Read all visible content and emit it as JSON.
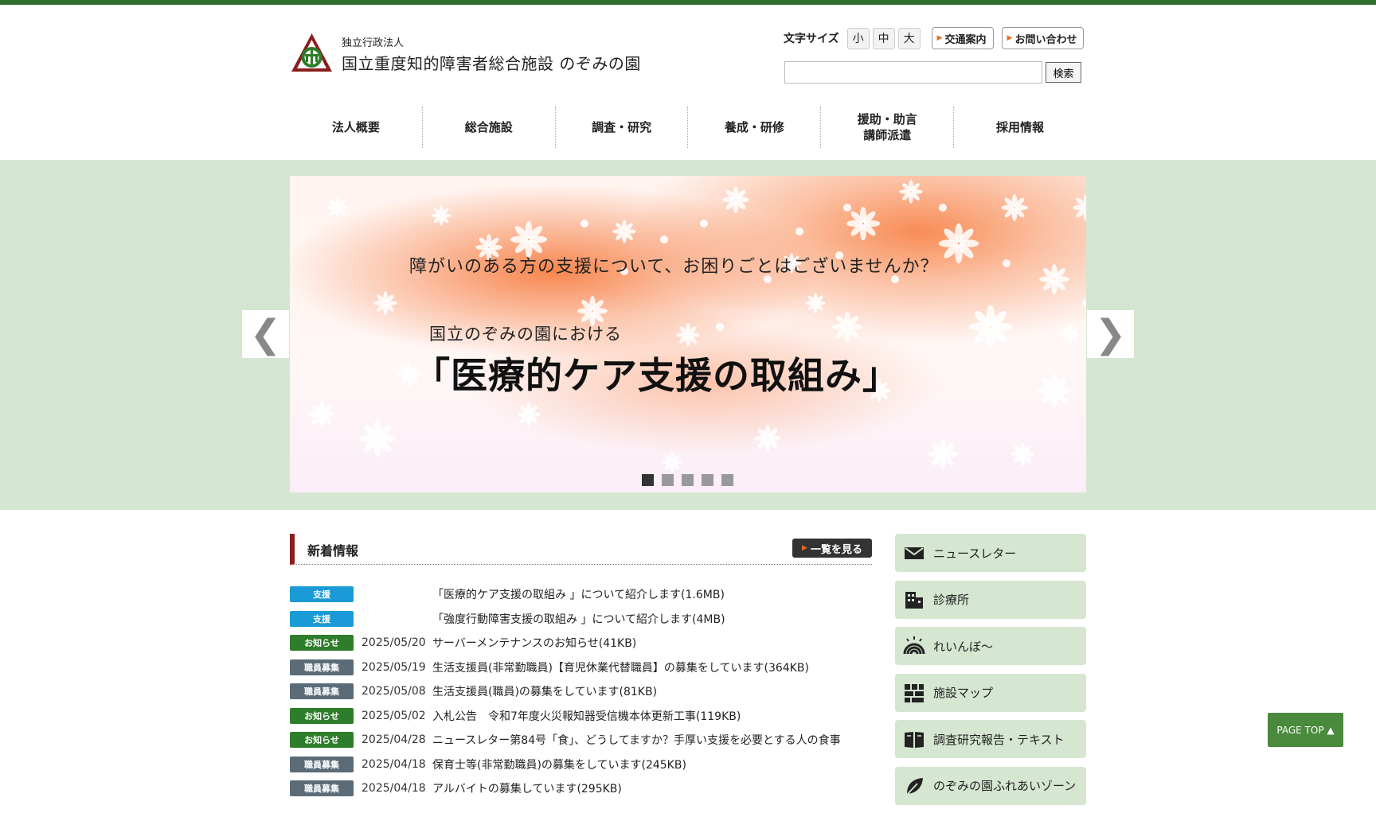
{
  "header": {
    "logo_sub": "独立行政法人",
    "logo_main": "国立重度知的障害者総合施設 のぞみの園",
    "font_size_label": "文字サイズ",
    "font_sizes": [
      "小",
      "中",
      "大"
    ],
    "access_label": "交通案内",
    "contact_label": "お問い合わせ",
    "search_button": "検索",
    "search_value": ""
  },
  "nav": {
    "items": [
      "法人概要",
      "総合施設",
      "調査・研究",
      "養成・研修",
      "援助・助言\n講師派遣",
      "採用情報"
    ]
  },
  "hero": {
    "question": "障がいのある方の支援について、お困りごとはございませんか？",
    "subtitle": "国立のぞみの園における",
    "title": "「医療的ケア支援の取組み」",
    "prev_arrow": "❮",
    "next_arrow": "❯",
    "slide_count": 5,
    "active_slide": 1
  },
  "news": {
    "title": "新着情報",
    "more_label": "一覧を見る",
    "items": [
      {
        "category": "支援",
        "color": "#1a9ad6",
        "date": "",
        "text": "「医療的ケア支援の取組み 」について紹介します(1.6MB)"
      },
      {
        "category": "支援",
        "color": "#1a9ad6",
        "date": "",
        "text": "「強度行動障害支援の取組み 」について紹介します(4MB)"
      },
      {
        "category": "お知らせ",
        "color": "#2e7d2a",
        "date": "2025/05/20",
        "text": "サーバーメンテナンスのお知らせ(41KB)"
      },
      {
        "category": "職員募集",
        "color": "#5b6b78",
        "date": "2025/05/19",
        "text": "生活支援員(非常勤職員)【育児休業代替職員】の募集をしています(364KB)"
      },
      {
        "category": "職員募集",
        "color": "#5b6b78",
        "date": "2025/05/08",
        "text": "生活支援員(職員)の募集をしています(81KB)"
      },
      {
        "category": "お知らせ",
        "color": "#2e7d2a",
        "date": "2025/05/02",
        "text": "入札公告　令和7年度火災報知器受信機本体更新工事(119KB)"
      },
      {
        "category": "お知らせ",
        "color": "#2e7d2a",
        "date": "2025/04/28",
        "text": "ニュースレター第84号「食」、どうしてますか？手厚い支援を必要とする人の食事"
      },
      {
        "category": "職員募集",
        "color": "#5b6b78",
        "date": "2025/04/18",
        "text": "保育士等(非常勤職員)の募集をしています(245KB)"
      },
      {
        "category": "職員募集",
        "color": "#5b6b78",
        "date": "2025/04/18",
        "text": "アルバイトの募集しています(295KB)"
      }
    ]
  },
  "sidebar": {
    "items": [
      {
        "label": "ニュースレター",
        "icon": "mail-icon"
      },
      {
        "label": "診療所",
        "icon": "building-icon"
      },
      {
        "label": "れいんぼ～",
        "icon": "rainbow-icon"
      },
      {
        "label": "施設マップ",
        "icon": "map-icon"
      },
      {
        "label": "調査研究報告・テキスト",
        "icon": "book-icon"
      },
      {
        "label": "のぞみの園ふれあいゾーン",
        "icon": "leaf-icon"
      }
    ]
  },
  "page_top": "PAGE TOP ▲"
}
